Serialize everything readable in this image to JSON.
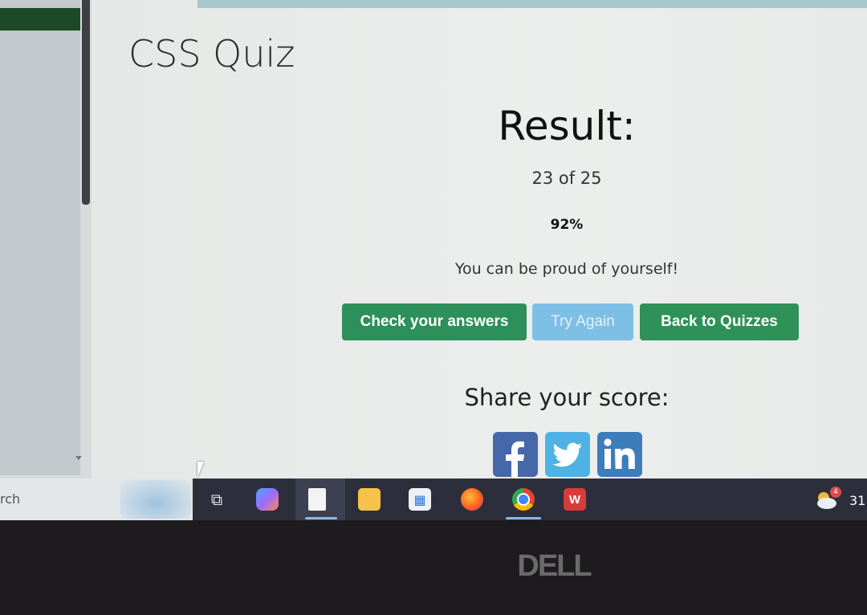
{
  "page": {
    "quiz_title": "CSS Quiz",
    "result_heading": "Result:",
    "score": "23 of 25",
    "percent": "92%",
    "message": "You can be proud of yourself!",
    "share_heading": "Share your score:"
  },
  "buttons": {
    "check": "Check your answers",
    "try": "Try Again",
    "back": "Back to Quizzes"
  },
  "social": [
    "facebook-icon",
    "twitter-icon",
    "linkedin-icon"
  ],
  "taskbar": {
    "search_text": "rch",
    "weather_badge": "4",
    "tray_text": "31"
  },
  "bezel": {
    "brand": "DELL"
  },
  "colors": {
    "green_button": "#2d8f5a",
    "blue_button": "#7ebfe5",
    "facebook": "#4667a8",
    "twitter": "#4fb2e4",
    "linkedin": "#3d7dbb"
  }
}
